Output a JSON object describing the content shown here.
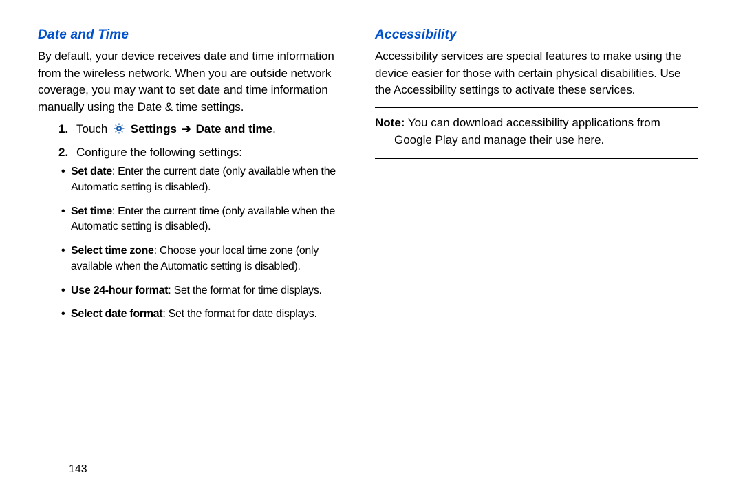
{
  "left": {
    "heading": "Date and Time",
    "intro": "By default, your device receives date and time information from the wireless network. When you are outside network coverage, you may want to set date and time information manually using the Date & time settings.",
    "step1_prefix": "Touch",
    "step1_settings": "Settings",
    "step1_arrow": "➔",
    "step1_target": "Date and time",
    "step1_period": ".",
    "step2": "Configure the following settings:",
    "bullets": [
      {
        "title": "Set date",
        "desc": ": Enter the current date (only available when the Automatic setting is disabled)."
      },
      {
        "title": "Set time",
        "desc": ": Enter the current time (only available when the Automatic setting is disabled)."
      },
      {
        "title": "Select time zone",
        "desc": ": Choose your local time zone (only available when the Automatic setting is disabled)."
      },
      {
        "title": "Use 24-hour format",
        "desc": ": Set the format for time displays."
      },
      {
        "title": "Select date format",
        "desc": ": Set the format for date displays."
      }
    ]
  },
  "right": {
    "heading": "Accessibility",
    "intro": "Accessibility services are special features to make using the device easier for those with certain physical disabilities. Use the Accessibility settings to activate these services.",
    "note_label": "Note:",
    "note_line1": " You can download accessibility applications from",
    "note_line2": "Google Play and manage their use here."
  },
  "page_number": "143",
  "markers": {
    "bullet": "•",
    "num1": "1.",
    "num2": "2."
  }
}
